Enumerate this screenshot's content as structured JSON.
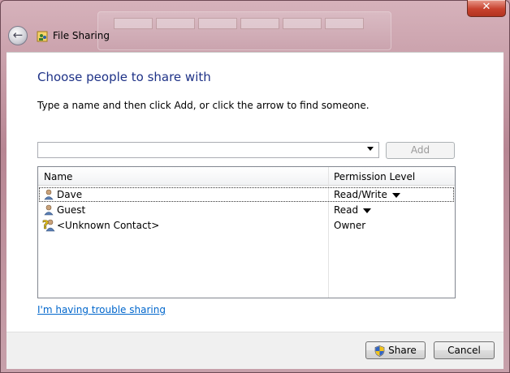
{
  "window": {
    "title": "File Sharing",
    "close_glyph": "✕",
    "back_glyph": "←",
    "title_icon": "file-sharing-icon"
  },
  "main": {
    "heading": "Choose people to share with",
    "instruction": "Type a name and then click Add, or click the arrow to find someone.",
    "name_input": {
      "value": "",
      "placeholder": ""
    },
    "add_label": "Add"
  },
  "list": {
    "columns": [
      "Name",
      "Permission Level"
    ],
    "rows": [
      {
        "name": "Dave",
        "permission": "Read/Write",
        "has_dropdown": true,
        "icon": "user-icon",
        "selected": true
      },
      {
        "name": "Guest",
        "permission": "Read",
        "has_dropdown": true,
        "icon": "user-icon",
        "selected": false
      },
      {
        "name": "<Unknown Contact>",
        "permission": "Owner",
        "has_dropdown": false,
        "icon": "unknown-contact-icon",
        "selected": false
      }
    ]
  },
  "help_link": "I'm having trouble sharing",
  "footer": {
    "share_label": "Share",
    "share_icon": "uac-shield-icon",
    "cancel_label": "Cancel"
  },
  "colors": {
    "heading": "#1e3287",
    "link": "#0066cc",
    "frame": "#c79aa6"
  }
}
